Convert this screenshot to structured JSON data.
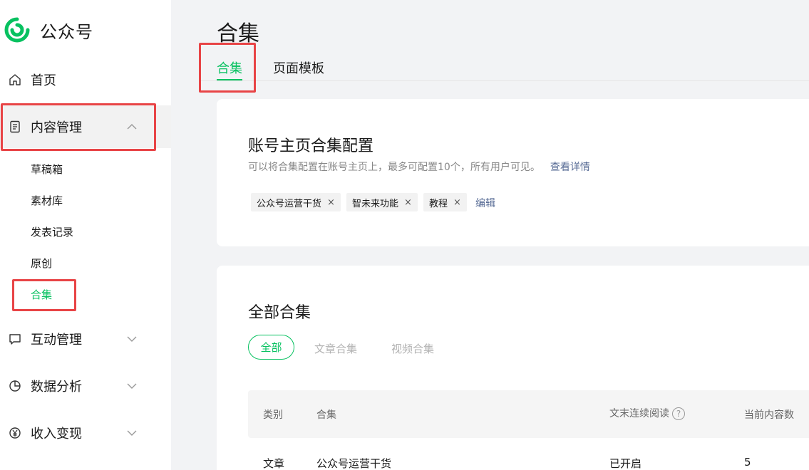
{
  "app": {
    "name": "公众号"
  },
  "sidebar": {
    "items": [
      {
        "label": "首页",
        "icon": "home-icon"
      },
      {
        "label": "内容管理",
        "icon": "document-icon"
      },
      {
        "label": "互动管理",
        "icon": "chat-icon"
      },
      {
        "label": "数据分析",
        "icon": "pie-chart-icon"
      },
      {
        "label": "收入变现",
        "icon": "yen-icon"
      }
    ],
    "content_sub": [
      "草稿箱",
      "素材库",
      "发表记录",
      "原创",
      "合集"
    ]
  },
  "page": {
    "title": "合集",
    "tabs": [
      "合集",
      "页面模板"
    ]
  },
  "homepage_config": {
    "title": "账号主页合集配置",
    "desc": "可以将合集配置在账号主页上，最多可配置10个，所有用户可见。",
    "details_link": "查看详情",
    "tags": [
      "公众号运营干货",
      "智未来功能",
      "教程"
    ],
    "remove_symbol": "×",
    "edit": "编辑"
  },
  "all_collections": {
    "title": "全部合集",
    "filters": [
      "全部",
      "文章合集",
      "视频合集"
    ],
    "columns": [
      "类别",
      "合集",
      "文末连续阅读",
      "当前内容数"
    ],
    "help_symbol": "?",
    "rows": [
      {
        "type": "文章",
        "name": "公众号运营干货",
        "continuous": "已开启",
        "count": "5"
      }
    ]
  },
  "colors": {
    "accent": "#07c160",
    "link": "#576b95",
    "highlight": "#e84446"
  }
}
